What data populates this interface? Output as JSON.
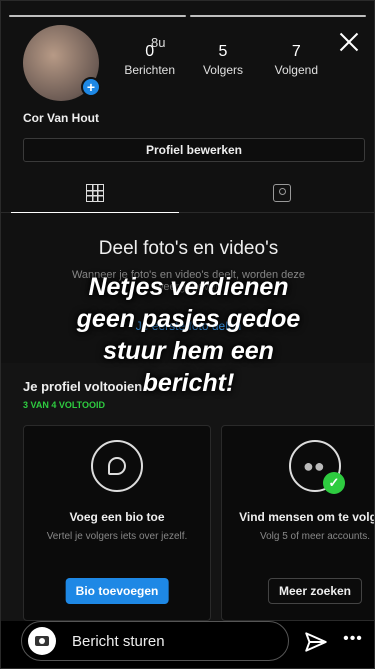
{
  "story": {
    "progress_segments": 2,
    "overlay_lines": [
      "Netjes verdienen",
      "geen pasjes gedoe",
      "stuur hem een",
      "bericht!"
    ]
  },
  "profile": {
    "time_ago": "8u",
    "stats": [
      {
        "num": "0",
        "label": "Berichten"
      },
      {
        "num": "5",
        "label": "Volgers"
      },
      {
        "num": "7",
        "label": "Volgend"
      }
    ],
    "name": "Cor Van Hout",
    "edit_label": "Profiel bewerken"
  },
  "tabs": [
    "grid-icon",
    "tagged-icon"
  ],
  "empty": {
    "title": "Deel foto's en video's",
    "subtitle": "Wanneer je foto's en video's deelt, worden deze weergegeven",
    "link": "Je eerste foto delen"
  },
  "complete_profile": {
    "title": "Je profiel voltooien",
    "count": "3 VAN 4 VOLTOOID",
    "cards": [
      {
        "icon": "chat-bubble-icon",
        "title": "Voeg een bio toe",
        "text": "Vertel je volgers iets over jezelf.",
        "button": "Bio toevoegen"
      },
      {
        "icon": "people-icon",
        "title": "Vind mensen om te volgen",
        "text": "Volg 5 of meer accounts.",
        "button": "Meer zoeken"
      }
    ]
  },
  "reply": {
    "placeholder": "Bericht sturen"
  },
  "colors": {
    "accent": "#1e88e5",
    "success": "#2ecc40"
  }
}
